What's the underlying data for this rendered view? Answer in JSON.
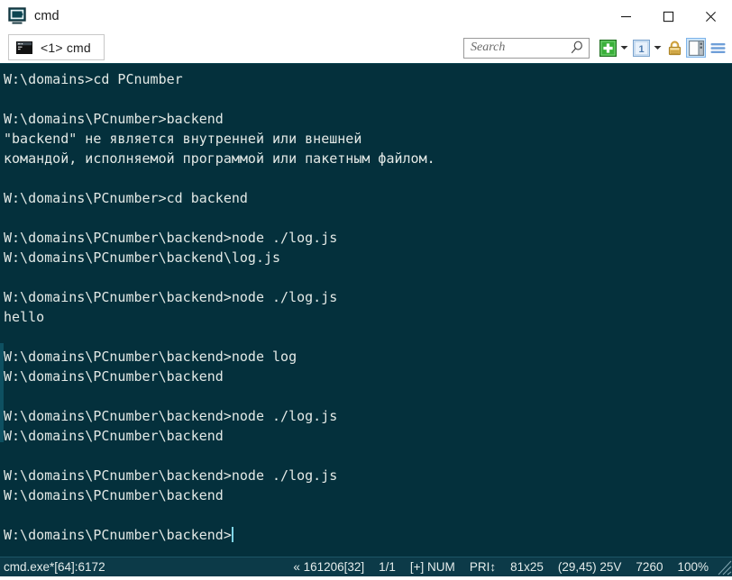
{
  "window": {
    "title": "cmd",
    "icon": "conemu-icon",
    "buttons": {
      "minimize": "minimize-icon",
      "maximize": "maximize-icon",
      "close": "close-icon"
    }
  },
  "tabbar": {
    "tabs": [
      {
        "label": "<1> cmd",
        "icon": "console-icon",
        "active": true
      }
    ]
  },
  "toolbar": {
    "search": {
      "placeholder": "Search",
      "value": "",
      "icon": "search-icon"
    },
    "buttons": [
      {
        "name": "new-console-button",
        "icon": "green-plus-icon"
      },
      {
        "name": "new-console-dropdown",
        "icon": "chevron-down-icon"
      },
      {
        "name": "active-console-button",
        "icon": "console-number-1-icon",
        "label": "1"
      },
      {
        "name": "active-console-dropdown",
        "icon": "chevron-down-icon"
      },
      {
        "name": "admin-lock-button",
        "icon": "padlock-icon"
      },
      {
        "name": "split-view-button",
        "icon": "panel-split-icon",
        "selected": true
      },
      {
        "name": "main-menu-button",
        "icon": "hamburger-menu-icon"
      }
    ]
  },
  "terminal": {
    "background": "#04303c",
    "foreground": "#e3e9e6",
    "cursor_color": "#7fd6e8",
    "lines": [
      "W:\\domains>cd PCnumber",
      "",
      "W:\\domains\\PCnumber>backend",
      "\"backend\" не является внутренней или внешней",
      "командой, исполняемой программой или пакетным файлом.",
      "",
      "W:\\domains\\PCnumber>cd backend",
      "",
      "W:\\domains\\PCnumber\\backend>node ./log.js",
      "W:\\domains\\PCnumber\\backend\\log.js",
      "",
      "W:\\domains\\PCnumber\\backend>node ./log.js",
      "hello",
      "",
      "W:\\domains\\PCnumber\\backend>node log",
      "W:\\domains\\PCnumber\\backend",
      "",
      "W:\\domains\\PCnumber\\backend>node ./log.js",
      "W:\\domains\\PCnumber\\backend",
      "",
      "W:\\domains\\PCnumber\\backend>node ./log.js",
      "W:\\domains\\PCnumber\\backend",
      "",
      "W:\\domains\\PCnumber\\backend>"
    ],
    "prompt_last": "W:\\domains\\PCnumber\\backend>"
  },
  "statusbar": {
    "process": "cmd.exe*[64]:6172",
    "cells": [
      "« 161206[32]",
      "1/1",
      "[+] NUM",
      "PRI↕",
      "81x25",
      "(29,45) 25V",
      "7260",
      "100%"
    ]
  },
  "colors": {
    "terminal_bg": "#04303c",
    "statusbar_bg": "#0c3a48",
    "chrome_bg": "#ffffff",
    "accent_green": "#3cb53c",
    "accent_blue": "#7eb4ea",
    "lock_gold": "#d9a648"
  }
}
